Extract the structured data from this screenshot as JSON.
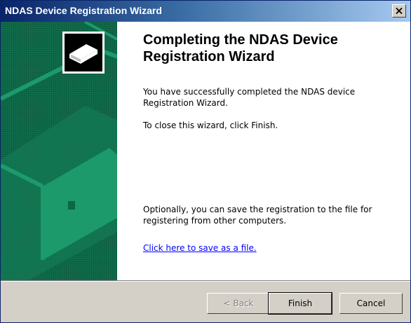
{
  "window": {
    "title": "NDAS Device Registration Wizard"
  },
  "content": {
    "heading": "Completing the NDAS Device Registration Wizard",
    "para1": "You have successfully completed the NDAS device Registration Wizard.",
    "para2": "To close this wizard, click Finish.",
    "para3": "Optionally, you can save the registration to the file for registering from other computers.",
    "link": "Click here to save as a file."
  },
  "buttons": {
    "back": "< Back",
    "finish": "Finish",
    "cancel": "Cancel"
  },
  "colors": {
    "sidebar": "#0d6646",
    "accent": "#21a075",
    "title_start": "#0a246a",
    "link": "#0000ff"
  },
  "icons": {
    "device": "device-icon",
    "close": "close-icon"
  }
}
